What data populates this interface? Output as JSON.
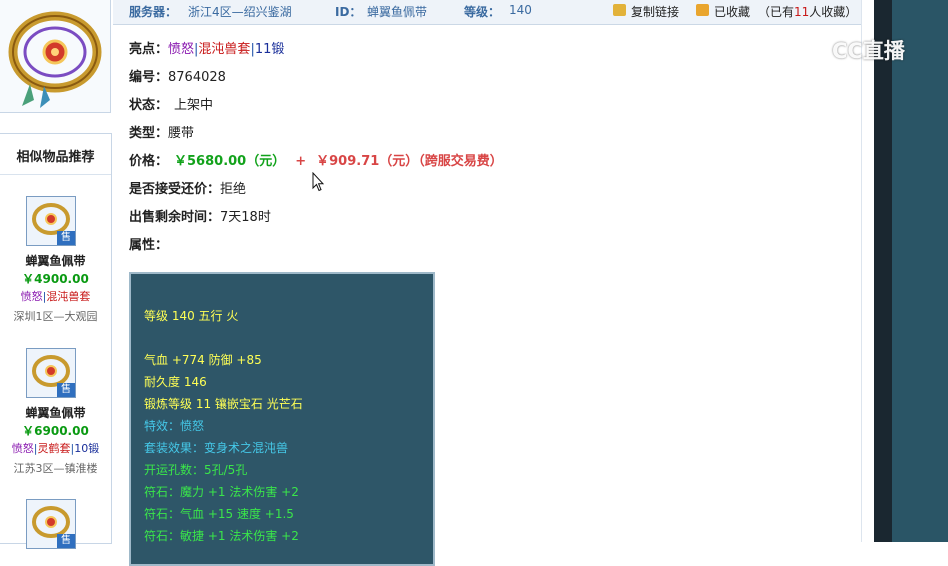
{
  "header": {
    "server_label": "服务器：",
    "server_value": "浙江4区—绍兴鉴湖",
    "id_label": "ID：",
    "id_value": "蝉翼鱼佩带",
    "level_label": "等级：",
    "level_value": "140",
    "copy_link": "复制链接",
    "favorited": "已收藏",
    "fav_count_prefix": "（已有",
    "fav_count": "11",
    "fav_count_suffix": "人收藏）"
  },
  "detail": {
    "highlight_label": "亮点：",
    "highlight_tags": [
      "愤怒",
      "混沌兽套",
      "11锻"
    ],
    "number_label": "编号：",
    "number_value": "8764028",
    "status_label": "状态：",
    "status_value": "上架中",
    "type_label": "类型：",
    "type_value": "腰带",
    "price_label": "价格：",
    "price_main": "￥5680.00（元）",
    "price_plus": "+",
    "price_fee": "￥909.71（元）（跨服交易费）",
    "counter_label": "是否接受还价：",
    "counter_value": "拒绝",
    "remaining_label": "出售剩余时间：",
    "remaining_value": "7天18时",
    "attr_label": "属性："
  },
  "attributes": [
    {
      "text": "等级 140 五行 火",
      "color": "yellow"
    },
    {
      "text": "气血 +774 防御 +85",
      "color": "yellow"
    },
    {
      "text": "耐久度 146",
      "color": "yellow"
    },
    {
      "text": "锻炼等级 11 镶嵌宝石 光芒石",
      "color": "yellow"
    },
    {
      "text": "特效：愤怒",
      "color": "cyan"
    },
    {
      "text": "套装效果：变身术之混沌兽",
      "color": "cyan"
    },
    {
      "text": "开运孔数：5孔/5孔",
      "color": "green"
    },
    {
      "text": "符石：魔力 +1 法术伤害 +2",
      "color": "green"
    },
    {
      "text": "符石：气血 +15 速度 +1.5",
      "color": "green"
    },
    {
      "text": "符石：敏捷 +1 法术伤害 +2",
      "color": "green"
    }
  ],
  "sidebar": {
    "title": "相似物品推荐",
    "sell_badge": "售",
    "items": [
      {
        "name": "蝉翼鱼佩带",
        "price": "￥4900.00",
        "tags": [
          "愤怒",
          "混沌兽套"
        ],
        "server": "深圳1区—大观园"
      },
      {
        "name": "蝉翼鱼佩带",
        "price": "￥6900.00",
        "tags": [
          "愤怒",
          "灵鹤套",
          "10锻"
        ],
        "server": "江苏3区—镇淮楼"
      },
      {
        "name": "",
        "price": "",
        "tags": [],
        "server": ""
      }
    ]
  },
  "watermark": {
    "text": "CC直播"
  },
  "colors": {
    "header_text": "#3a6aa0",
    "price_green": "#12a21b",
    "price_red": "#d84545",
    "attr_bg": "#2e5668",
    "attr_yellow": "#ffff55",
    "attr_cyan": "#45c8e8",
    "attr_green": "#3ae64a",
    "right_panel": "#2a5566"
  },
  "icons": [
    "belt-item-icon",
    "copy-link-icon",
    "favorite-icon",
    "sell-badge",
    "cc-live-logo-icon",
    "mouse-cursor-icon"
  ]
}
